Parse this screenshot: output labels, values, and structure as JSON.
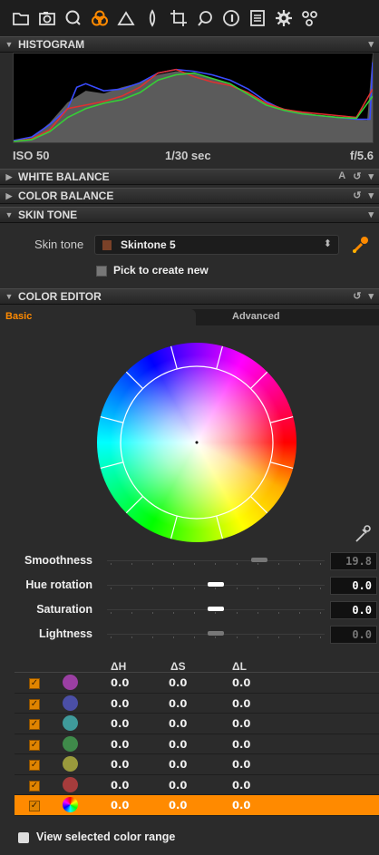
{
  "toolbar": {
    "icons": [
      "library-icon",
      "capture-icon",
      "lens-icon",
      "color-icon",
      "exposure-icon",
      "details-icon",
      "crop-icon",
      "adjustments-icon",
      "metadata-icon",
      "output-icon",
      "settings-icon",
      "batch-icon"
    ],
    "active_color": "#ff8a00"
  },
  "histogram": {
    "title": "HISTOGRAM",
    "iso": "ISO 50",
    "shutter": "1/30 sec",
    "aperture": "f/5.6"
  },
  "sections": {
    "white_balance": {
      "title": "WHITE BALANCE",
      "auto": "A"
    },
    "color_balance": {
      "title": "COLOR BALANCE"
    },
    "skin_tone": {
      "title": "SKIN TONE"
    },
    "color_editor": {
      "title": "COLOR EDITOR"
    }
  },
  "skin_tone": {
    "label": "Skin tone",
    "selected": "Skintone 5",
    "swatch_color": "#7a4128",
    "pick_label": "Pick to create new"
  },
  "color_editor": {
    "tabs": [
      "Basic",
      "Advanced"
    ],
    "active_tab": "Basic",
    "sliders": [
      {
        "label": "Smoothness",
        "value": "19.8",
        "position": 0.7,
        "enabled": false
      },
      {
        "label": "Hue rotation",
        "value": "0.0",
        "position": 0.5,
        "enabled": true
      },
      {
        "label": "Saturation",
        "value": "0.0",
        "position": 0.5,
        "enabled": true
      },
      {
        "label": "Lightness",
        "value": "0.0",
        "position": 0.5,
        "enabled": false
      }
    ],
    "table": {
      "headers": [
        "ΔH",
        "ΔS",
        "ΔL"
      ],
      "rows": [
        {
          "color": "#9b3fa3",
          "dh": "0.0",
          "ds": "0.0",
          "dl": "0.0",
          "checked": true,
          "selected": false
        },
        {
          "color": "#4b4fa6",
          "dh": "0.0",
          "ds": "0.0",
          "dl": "0.0",
          "checked": true,
          "selected": false
        },
        {
          "color": "#3f9a9a",
          "dh": "0.0",
          "ds": "0.0",
          "dl": "0.0",
          "checked": true,
          "selected": false
        },
        {
          "color": "#3f8a4a",
          "dh": "0.0",
          "ds": "0.0",
          "dl": "0.0",
          "checked": true,
          "selected": false
        },
        {
          "color": "#9a9a3c",
          "dh": "0.0",
          "ds": "0.0",
          "dl": "0.0",
          "checked": true,
          "selected": false
        },
        {
          "color": "#a63c3c",
          "dh": "0.0",
          "ds": "0.0",
          "dl": "0.0",
          "checked": true,
          "selected": false
        },
        {
          "color": "rainbow",
          "dh": "0.0",
          "ds": "0.0",
          "dl": "0.0",
          "checked": true,
          "selected": true
        }
      ]
    },
    "view_range_label": "View selected color range"
  }
}
